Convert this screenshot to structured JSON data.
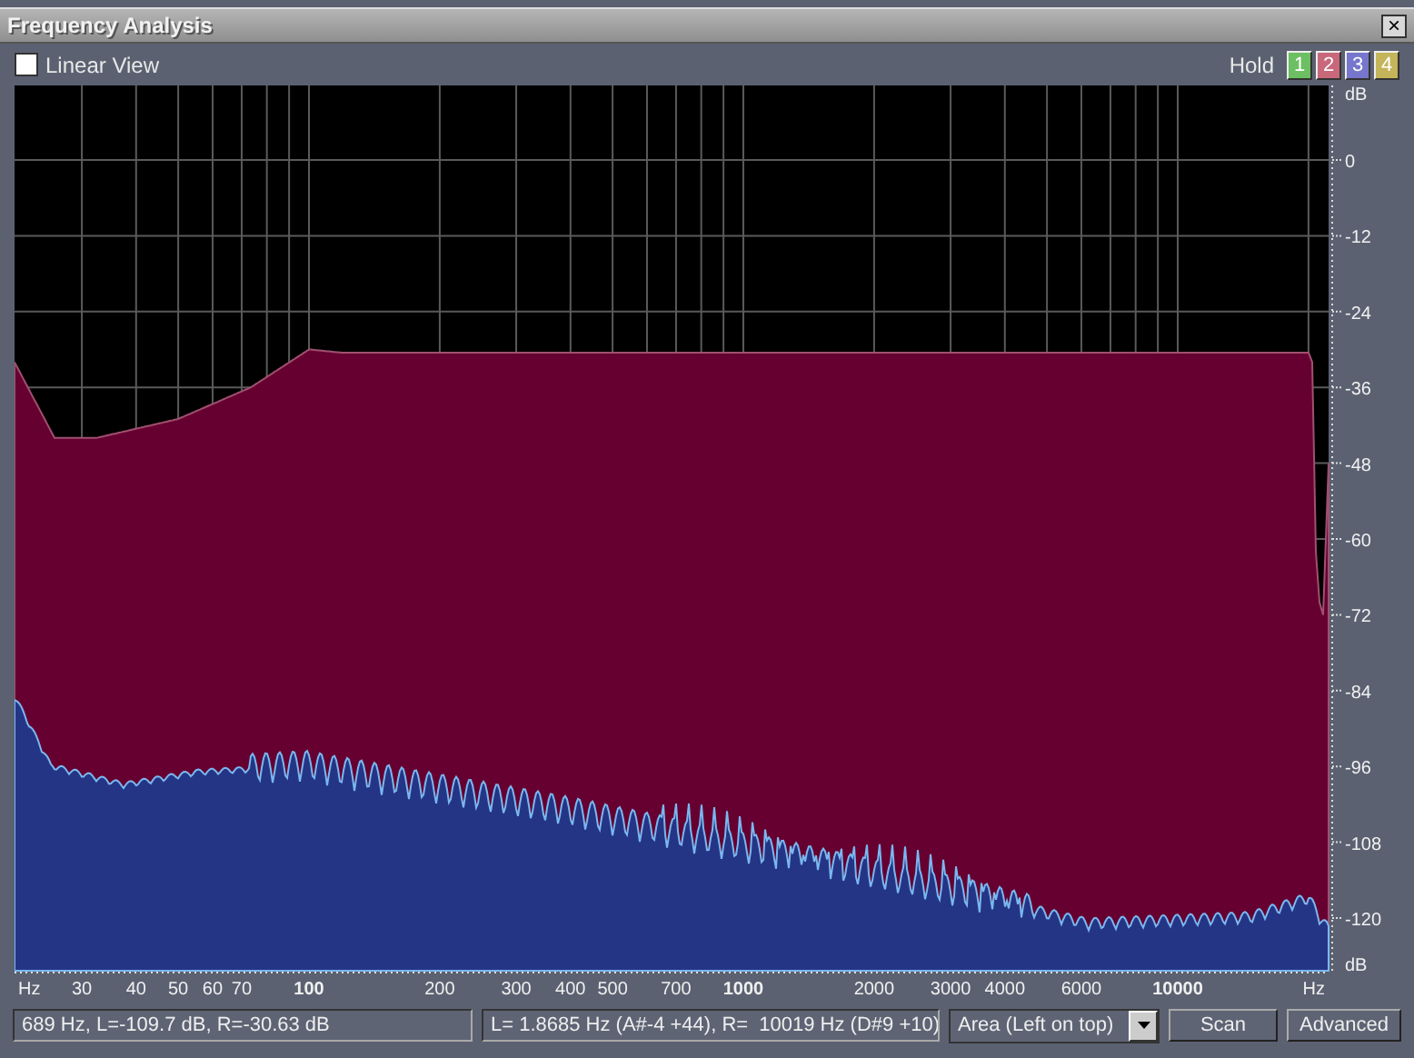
{
  "window": {
    "title": "Frequency Analysis",
    "close_label": "×"
  },
  "toolbar": {
    "linear_view": {
      "label": "Linear View",
      "checked": false
    },
    "hold_label": "Hold",
    "hold_buttons": [
      {
        "label": "1",
        "color": "#6cbf62"
      },
      {
        "label": "2",
        "color": "#c8687a"
      },
      {
        "label": "3",
        "color": "#7676cc"
      },
      {
        "label": "4",
        "color": "#c4b45a"
      }
    ]
  },
  "chart": {
    "y_labels": [
      "dB",
      "0",
      "-12",
      "-24",
      "-36",
      "-48",
      "-60",
      "-72",
      "-84",
      "-96",
      "-108",
      "-120",
      "dB"
    ],
    "x_labels": [
      "Hz",
      "30",
      "40",
      "50",
      "60",
      "70",
      "100",
      "200",
      "300",
      "400",
      "500",
      "700",
      "1000",
      "2000",
      "3000",
      "4000",
      "6000",
      "10000",
      "Hz"
    ]
  },
  "status_bar": {
    "cursor_readout": "689 Hz, L=-109.7 dB, R=-30.63 dB",
    "peak_readout": "L= 1.8685 Hz (A#-4 +44), R=  10019 Hz (D#9 +10)",
    "display_mode": "Area (Left on top)",
    "buttons": [
      "Scan",
      "Advanced"
    ]
  }
}
